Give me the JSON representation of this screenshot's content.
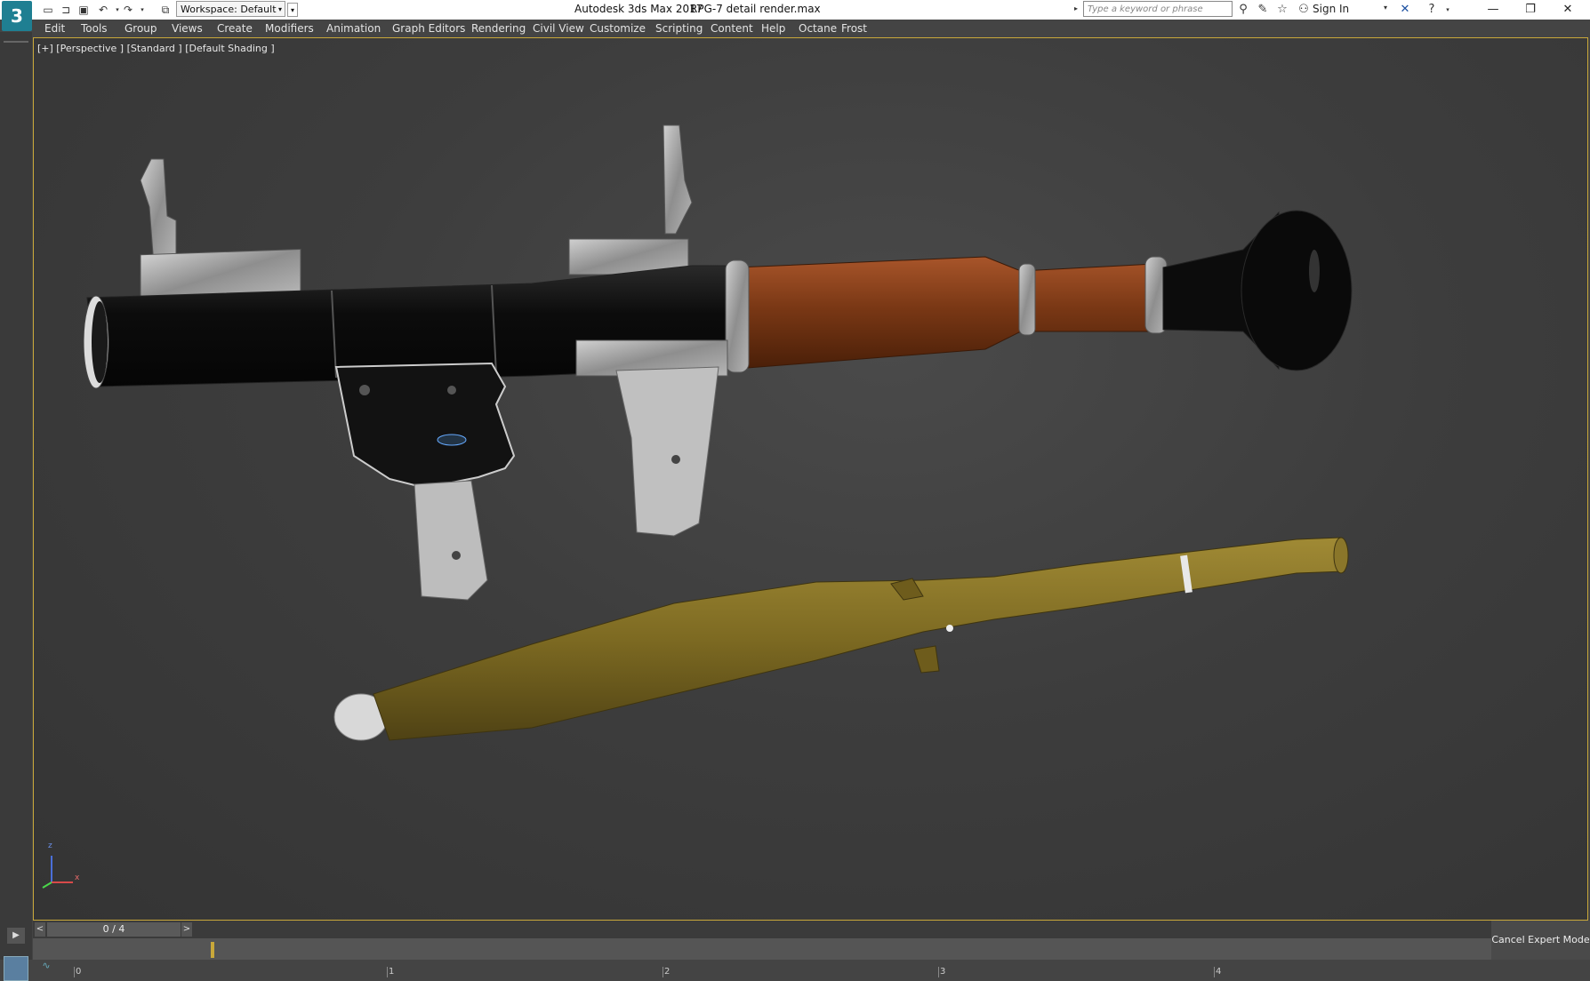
{
  "titlebar": {
    "logo": "3",
    "workspace": "Workspace: Default",
    "app_title": "Autodesk 3ds Max 2017",
    "file_name": "RPG-7 detail render.max",
    "search_placeholder": "Type a keyword or phrase",
    "sign_in": "Sign In"
  },
  "menu": [
    "Edit",
    "Tools",
    "Group",
    "Views",
    "Create",
    "Modifiers",
    "Animation",
    "Graph Editors",
    "Rendering",
    "Civil View",
    "Customize",
    "Scripting",
    "Content",
    "Help",
    "Octane",
    "Frost"
  ],
  "viewport": {
    "label": "[+] [Perspective ] [Standard ] [Default Shading ]",
    "axis_z": "z",
    "axis_x": "x"
  },
  "timeline": {
    "frame": "0 / 4",
    "prev": "<",
    "next": ">",
    "ticks": [
      "0",
      "1",
      "2",
      "3",
      "4"
    ],
    "current_frame": 0,
    "total_frames": 4
  },
  "status": {
    "cancel_expert_mode": "Cancel Expert Mode"
  },
  "colors": {
    "viewport_border": "#c9a83a",
    "launcher_black": "#111111",
    "wood": "#7a3815",
    "grenade_olive": "#7d6a22",
    "metal_grey": "#9c9c9c"
  }
}
